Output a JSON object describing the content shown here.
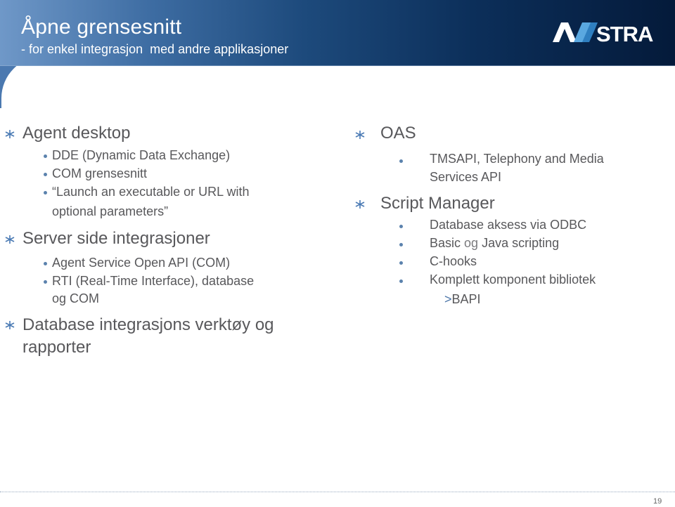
{
  "header": {
    "title": "Åpne grensesnitt",
    "subtitle": "- for enkel integrasjon  med andre applikasjoner",
    "logo_text": "AASTRA"
  },
  "left_column": {
    "sections": [
      {
        "heading": "Agent desktop",
        "items": [
          "DDE (Dynamic Data Exchange)",
          "COM grensesnitt",
          "“Launch an executable or URL with",
          "optional parameters”"
        ]
      },
      {
        "heading": "Server side integrasjoner",
        "items": [
          "Agent Service Open API (COM)",
          "RTI (Real-Time Interface), database",
          "og COM"
        ]
      },
      {
        "heading_line1": "Database integrasjons verktøy og",
        "heading_line2": "rapporter"
      }
    ]
  },
  "right_column": {
    "sections": [
      {
        "heading": "OAS",
        "items": [
          "TMSAPI, Telephony and Media",
          "Services API"
        ]
      },
      {
        "heading": "Script Manager",
        "items": [
          "Database aksess via ODBC",
          "Basic",
          "og",
          "Java scripting",
          "C-hooks",
          "Komplett komponent bibliotek"
        ],
        "sub_items": [
          {
            "marker": ">",
            "label": "BAPI"
          }
        ]
      }
    ]
  },
  "footer": {
    "page_number": "19"
  },
  "colors": {
    "bullet": "#5b82ad",
    "text": "#58585b",
    "header_dark": "#041a3a",
    "header_light": "#6f98c8"
  }
}
